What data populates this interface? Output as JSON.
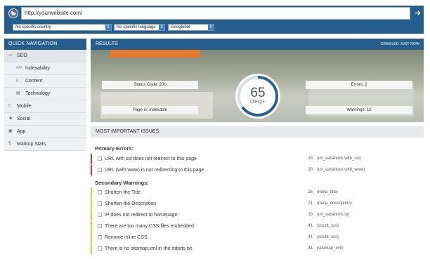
{
  "topbar": {
    "url": "http://yourwebsite.com/",
    "go_icon": "arrow-right-icon",
    "country": "No specific country",
    "language": "No specific language",
    "bot": "Googlebot"
  },
  "sidebar": {
    "title": "QUICK NAVIGATION",
    "items": [
      {
        "label": "SEO",
        "icon": "seo-icon",
        "active": true
      },
      {
        "label": "Indexability",
        "icon": "code-icon"
      },
      {
        "label": "Content",
        "icon": "document-icon"
      },
      {
        "label": "Technology",
        "icon": "server-icon"
      },
      {
        "label": "Mobile",
        "icon": "mobile-icon"
      },
      {
        "label": "Social",
        "icon": "users-icon"
      },
      {
        "label": "App",
        "icon": "app-icon"
      },
      {
        "label": "Markup Stats",
        "icon": "paragraph-icon"
      }
    ]
  },
  "results": {
    "title": "RESULTS",
    "crawled": "CRAWLED JUST NOW",
    "status_code": "Status Code: 200",
    "page_status": "Page is: indexable",
    "errors": "Errors: 2",
    "warnings": "Warnings: 12",
    "score": "65",
    "score_unit": "OPQ+",
    "score_fraction": 0.65,
    "issues_title": "MOST IMPORTANT ISSUES:"
  },
  "issues": {
    "primary_title": "Primary Errors:",
    "primary": [
      {
        "label": "URL with ssl does not redirect to this page",
        "count": "33",
        "code": "(url_variations:with_ssl)"
      },
      {
        "label": "URL (with www) is not redirecting to this page",
        "count": "33",
        "code": "(url_variations:with_www)"
      }
    ],
    "secondary_title": "Secondary Warnings:",
    "secondary": [
      {
        "label": "Shorten the Title",
        "count": "16",
        "code": "(meta_title)"
      },
      {
        "label": "Shorten the Description",
        "count": "21",
        "code": "(meta_description)"
      },
      {
        "label": "IP does not redirect to homepage",
        "count": "33",
        "code": "(url_variations:ip)"
      },
      {
        "label": "There are too many CSS files embedded",
        "count": "41",
        "code": "(count_css)"
      },
      {
        "label": "Remove inline CSS",
        "count": "41",
        "code": "(count_css)"
      },
      {
        "label": "There is no sitemap.xml in the robots.txt.",
        "count": "41",
        "code": "(sitemap_xml)"
      }
    ],
    "colors": {
      "error": "#d9352b",
      "warning": "#f0c419"
    }
  },
  "colors": {
    "brand": "#255e8d",
    "gauge_arc": "#2b5f8c"
  }
}
